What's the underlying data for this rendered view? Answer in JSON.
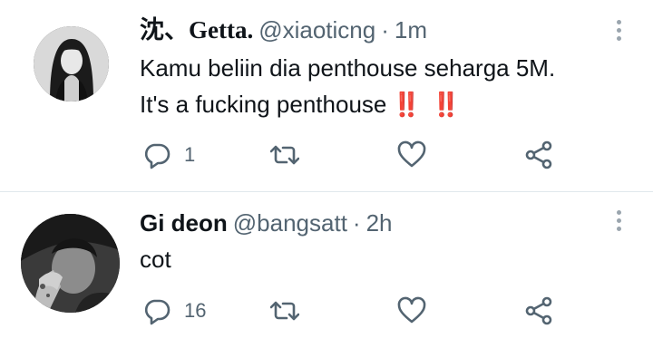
{
  "tweets": [
    {
      "display_name": "沈、Getta.",
      "handle": "@xiaoticng",
      "separator": "·",
      "time": "1m",
      "text_line1": "Kamu beliin dia penthouse seharga 5M.",
      "text_line2": "It's a fucking penthouse",
      "emoji": [
        "‼️",
        "‼️"
      ],
      "reply_count": "1",
      "avatar_icon": "woman-portrait-avatar"
    },
    {
      "display_name": "Gi deon",
      "handle": "@bangsatt",
      "separator": "·",
      "time": "2h",
      "text_line1": "cot",
      "reply_count": "16",
      "avatar_icon": "man-portrait-avatar"
    }
  ],
  "colors": {
    "text": "#0f1419",
    "secondary": "#536471",
    "divider": "#e1e8ed",
    "emoji": "#e0245e"
  }
}
